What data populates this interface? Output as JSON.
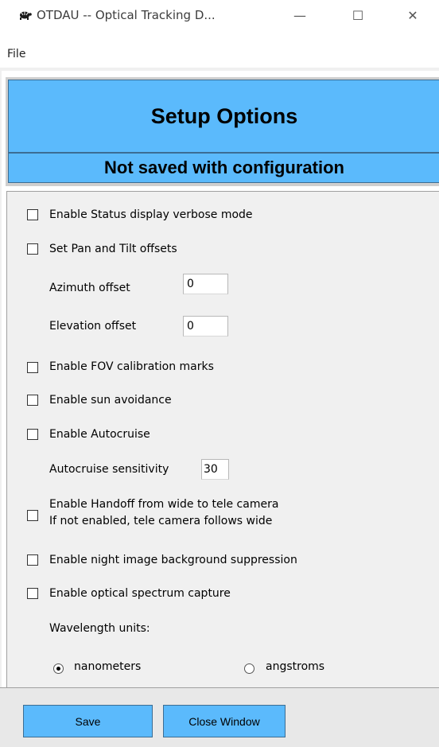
{
  "window": {
    "title": "OTDAU -- Optical Tracking D...",
    "icon": "turtle-app-icon",
    "controls": {
      "minimize": "—",
      "maximize": "☐",
      "close": "✕"
    }
  },
  "menu": {
    "file": "File"
  },
  "header": {
    "title": "Setup Options",
    "subtitle": "Not saved with configuration"
  },
  "options": {
    "status_verbose": {
      "label": "Enable Status display verbose mode",
      "checked": false
    },
    "pan_tilt": {
      "label": "Set Pan and Tilt offsets",
      "checked": false
    },
    "azimuth": {
      "label": "Azimuth offset",
      "value": "0"
    },
    "elevation": {
      "label": "Elevation offset",
      "value": "0"
    },
    "fov_marks": {
      "label": "Enable FOV calibration marks",
      "checked": false
    },
    "sun_avoid": {
      "label": "Enable sun avoidance",
      "checked": false
    },
    "autocruise": {
      "label": "Enable Autocruise",
      "checked": false
    },
    "autocruise_sens": {
      "label": "Autocruise sensitivity",
      "value": "30"
    },
    "handoff": {
      "label_line1": "Enable Handoff from wide to tele camera",
      "label_line2": "If not enabled, tele camera follows wide",
      "checked": false
    },
    "night_bg": {
      "label": "Enable night image background suppression",
      "checked": false
    },
    "spectrum": {
      "label": "Enable optical spectrum capture",
      "checked": false
    },
    "wavelength": {
      "label": "Wavelength units:",
      "options": [
        "nanometers",
        "angstroms"
      ],
      "selected": "nanometers"
    }
  },
  "buttons": {
    "save": "Save",
    "close_window": "Close Window"
  },
  "colors": {
    "accent": "#5bbafc",
    "accent_border": "#3c6d93",
    "panel": "#f0f0f0"
  }
}
